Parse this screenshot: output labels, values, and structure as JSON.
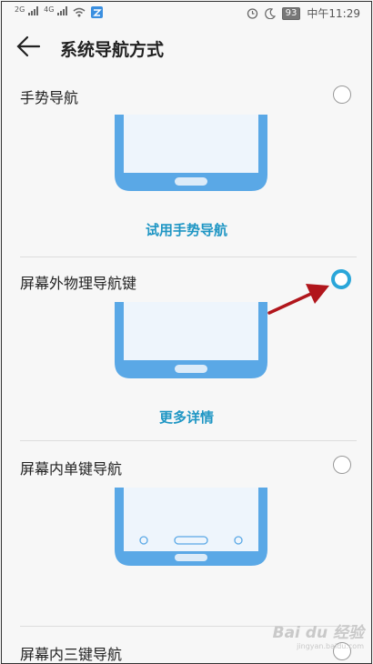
{
  "status_bar": {
    "signal1_label": "2G",
    "signal2_label": "4G",
    "battery": "93",
    "time": "中午11:29",
    "icons": [
      "signal-icon",
      "signal-icon",
      "wifi-icon",
      "app-notification-icon",
      "alarm-icon",
      "moon-icon",
      "battery-icon"
    ]
  },
  "header": {
    "title": "系统导航方式",
    "back_icon": "back-arrow-icon"
  },
  "options": [
    {
      "label": "手势导航",
      "selected": false,
      "action": "试用手势导航"
    },
    {
      "label": "屏幕外物理导航键",
      "selected": true,
      "action": "更多详情"
    },
    {
      "label": "屏幕内单键导航",
      "selected": false,
      "action": ""
    },
    {
      "label": "屏幕内三键导航",
      "selected": false,
      "action": ""
    }
  ],
  "watermark": {
    "brand": "Bai du 经验",
    "url": "jingyan.baidu.com"
  },
  "colors": {
    "accent": "#2aa6d9",
    "link": "#1f96c4",
    "phone_blue": "#5aa8e6",
    "arrow_red": "#b1161c"
  }
}
